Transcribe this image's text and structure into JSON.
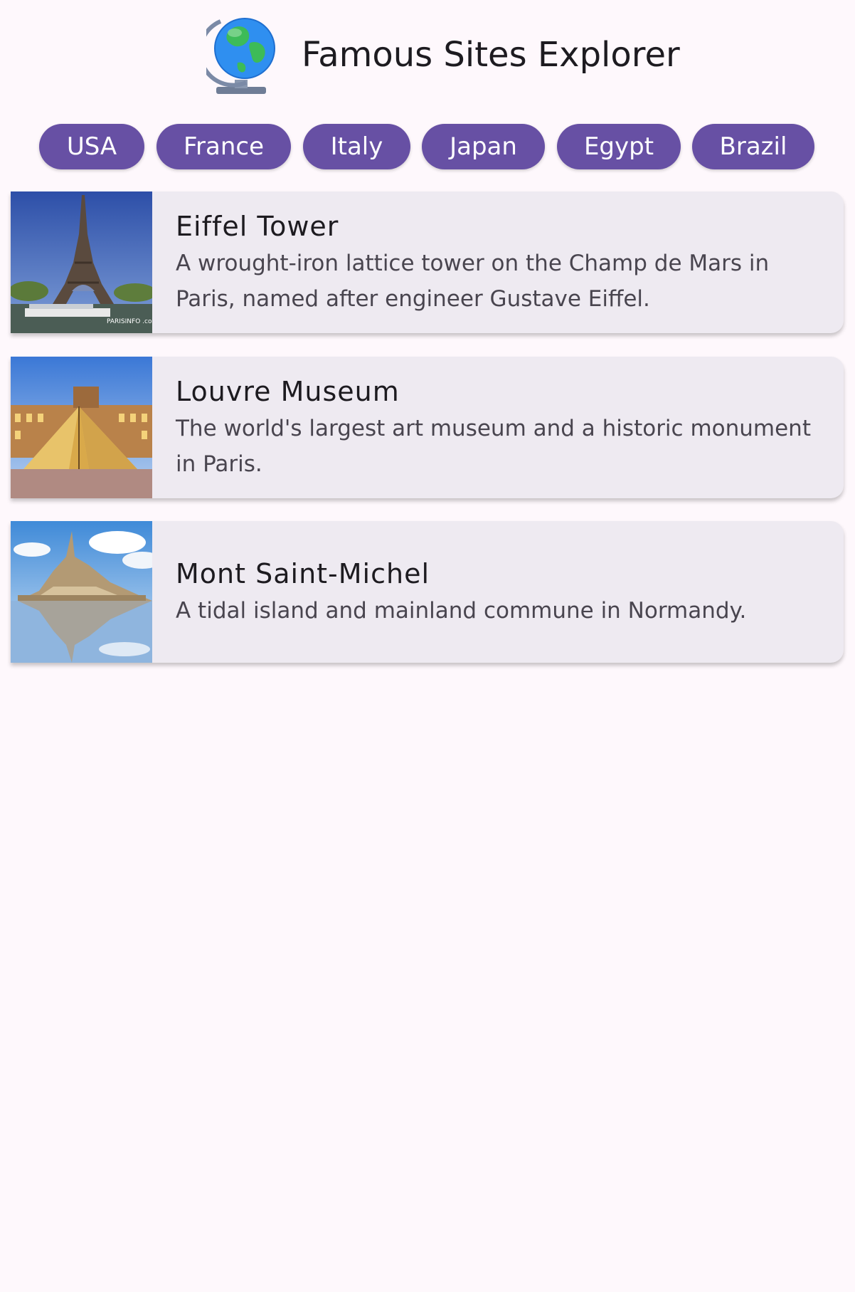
{
  "header": {
    "icon": "globe-icon",
    "title": "Famous Sites Explorer"
  },
  "countries": [
    {
      "label": "USA"
    },
    {
      "label": "France"
    },
    {
      "label": "Italy"
    },
    {
      "label": "Japan"
    },
    {
      "label": "Egypt"
    },
    {
      "label": "Brazil"
    }
  ],
  "sites": [
    {
      "name": "Eiffel Tower",
      "description": "A wrought-iron lattice tower on the Champ de Mars in Paris, named after engineer Gustave Eiffel.",
      "image_watermark": "PARISINFO .com"
    },
    {
      "name": "Louvre Museum",
      "description": "The world's largest art museum and a historic monument in Paris."
    },
    {
      "name": "Mont Saint-Michel",
      "description": "A tidal island and mainland commune in Normandy."
    }
  ],
  "colors": {
    "background": "#fef8fc",
    "chip": "#6750a4",
    "chip_text": "#ffffff",
    "card": "#eeeaf1",
    "title_text": "#1d1b20",
    "description_text": "#49454f"
  }
}
